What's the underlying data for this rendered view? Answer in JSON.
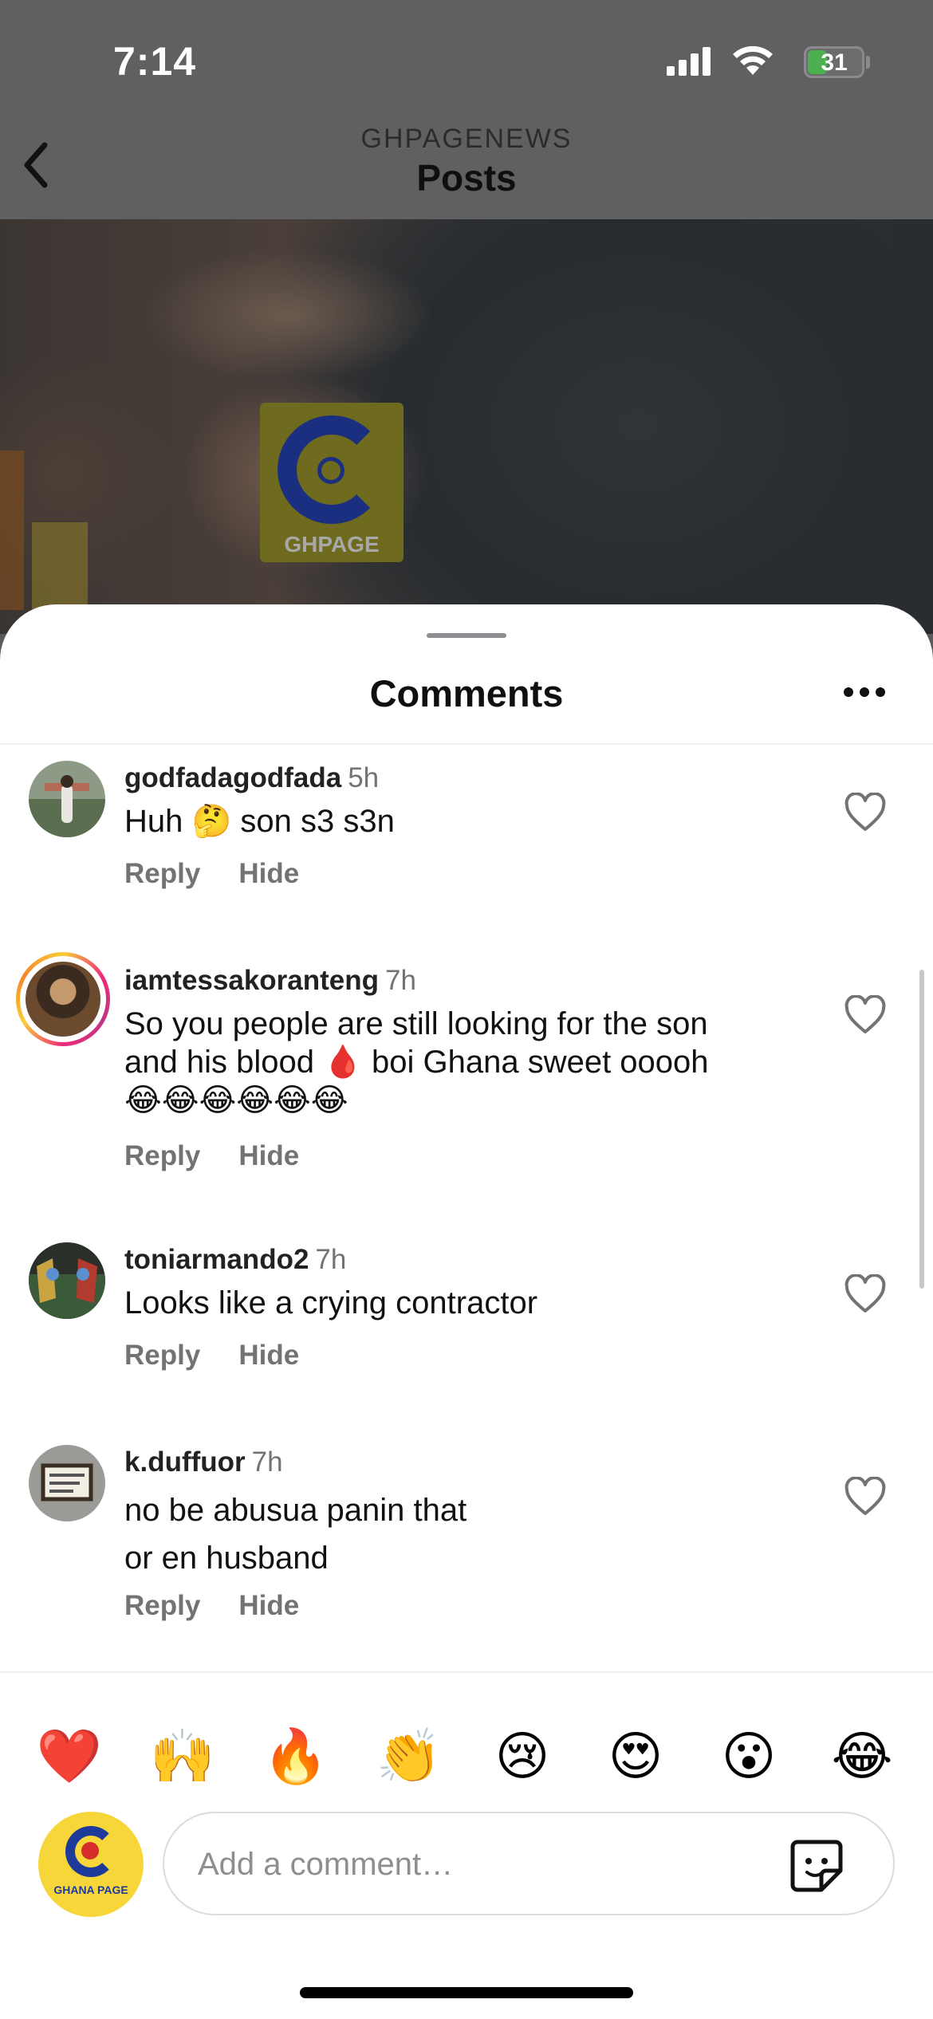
{
  "status_bar": {
    "time": "7:14",
    "battery": "31"
  },
  "header": {
    "account": "GHPAGENEWS",
    "title": "Posts"
  },
  "watermark": {
    "label": "GHPAGE"
  },
  "sheet": {
    "title": "Comments"
  },
  "comments": [
    {
      "username": "godfadagodfada",
      "ago": "5h",
      "lines": [
        "Huh 🤔 son s3 s3n"
      ],
      "reply": "Reply",
      "hide": "Hide"
    },
    {
      "username": "iamtessakoranteng",
      "ago": "7h",
      "lines": [
        "So you people are still looking for the son",
        "and his blood 🩸 boi Ghana sweet ooooh",
        "😂😂😂😂😂😂"
      ],
      "reply": "Reply",
      "hide": "Hide",
      "has_story_ring": true
    },
    {
      "username": "toniarmando2",
      "ago": "7h",
      "lines": [
        "Looks like a crying contractor"
      ],
      "reply": "Reply",
      "hide": "Hide"
    },
    {
      "username": "k.duffuor",
      "ago": "7h",
      "lines": [
        "no be abusua panin that",
        "or en husband"
      ],
      "reply": "Reply",
      "hide": "Hide"
    }
  ],
  "quick_reactions": [
    "❤️",
    "🙌",
    "🔥",
    "👏",
    "😢",
    "😍",
    "😮",
    "😂"
  ],
  "composer": {
    "placeholder": "Add a comment…",
    "avatar_label": "GHANA PAGE"
  },
  "colors": {
    "sheet_bg": "#ffffff",
    "muted_text": "#737373",
    "story_ring": "#ee2a7b",
    "page_yellow": "#f7d63a",
    "page_blue": "#1d3a9a"
  }
}
